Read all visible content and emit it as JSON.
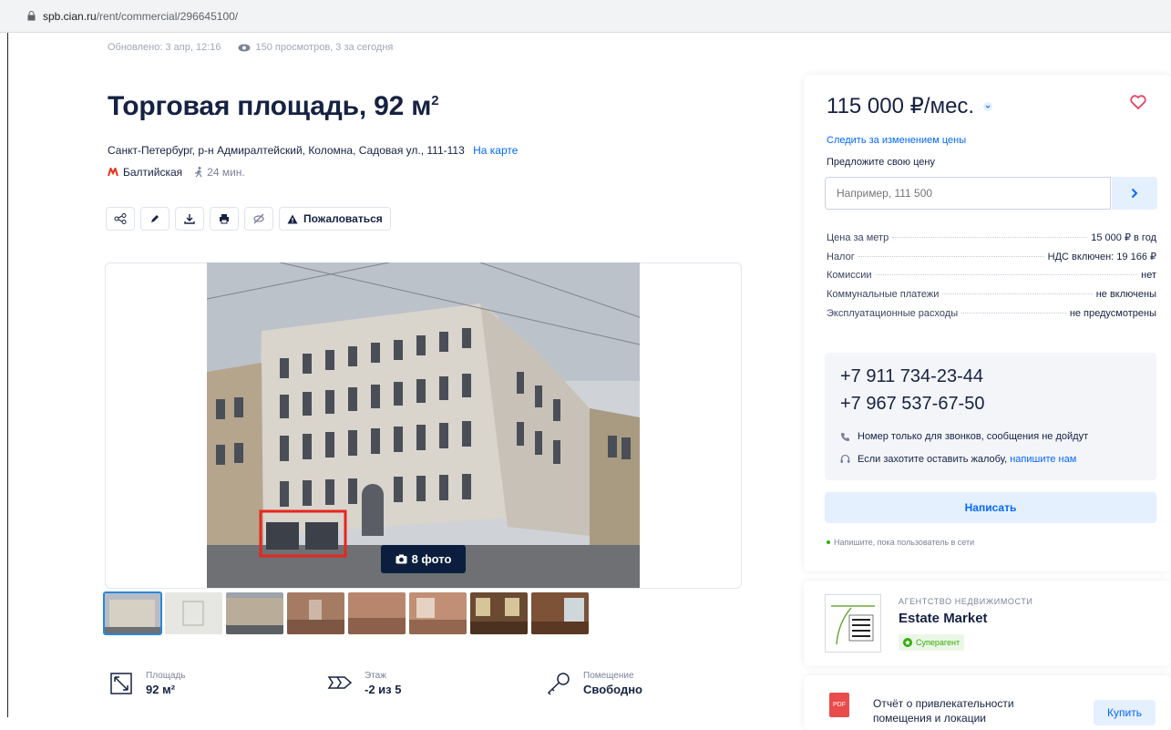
{
  "browser": {
    "url_host": "spb.cian.ru",
    "url_path": "/rent/commercial/296645100/"
  },
  "meta": {
    "updated": "Обновлено: 3 апр, 12:16",
    "views": "150 просмотров, 3 за сегодня"
  },
  "listing": {
    "title": "Торговая площадь, 92 м",
    "title_sup": "2",
    "address": "Санкт-Петербург, р-н Адмиралтейский, Коломна, Садовая ул., 111-113",
    "map_link": "На карте",
    "metro": "Балтийская",
    "metro_time": "24 мин."
  },
  "toolbar": {
    "report_label": "Пожаловаться"
  },
  "photos": {
    "badge": "8 фото"
  },
  "features": [
    {
      "label": "Площадь",
      "value": "92 м²"
    },
    {
      "label": "Этаж",
      "value": "-2 из 5"
    },
    {
      "label": "Помещение",
      "value": "Свободно"
    }
  ],
  "pricing": {
    "price": "115 000 ₽/мес.",
    "follow": "Следить за изменением цены",
    "offer_label": "Предложите свою цену",
    "offer_placeholder": "Например, 111 500",
    "terms": [
      {
        "k": "Цена за метр",
        "v": "15 000 ₽ в год"
      },
      {
        "k": "Налог",
        "v": "НДС включен: 19 166 ₽"
      },
      {
        "k": "Комиссии",
        "v": "нет"
      },
      {
        "k": "Коммунальные платежи",
        "v": "не включены"
      },
      {
        "k": "Эксплуатационные расходы",
        "v": "не предусмотрены"
      }
    ]
  },
  "contacts": {
    "phone1": "+7 911 734-23-44",
    "phone2": "+7 967 537-67-50",
    "note_calls": "Номер только для звонков, сообщения не дойдут",
    "note_complaint": "Если захотите оставить жалобу,",
    "note_complaint_link": "напишите нам",
    "write_button": "Написать",
    "online_hint": "Напишите, пока пользователь в сети"
  },
  "agency": {
    "caption": "АГЕНТСТВО НЕДВИЖИМОСТИ",
    "name": "Estate Market",
    "badge": "Суперагент",
    "logo_text": "ESTATE MARKET AGENCY"
  },
  "report": {
    "text": "Отчёт о привлекательности помещения и локации",
    "buy": "Купить",
    "pdf": "PDF"
  },
  "colors": {
    "accent": "#0468ff",
    "text": "#152242",
    "heart": "#e84260",
    "metro": "#e8311d",
    "highlight": "#e8261c"
  }
}
